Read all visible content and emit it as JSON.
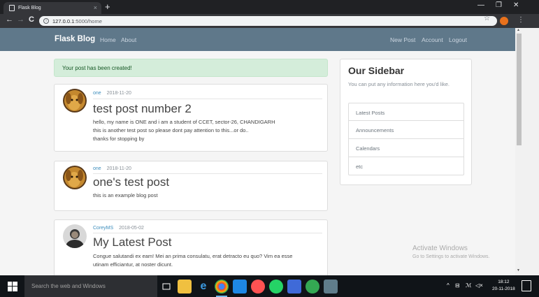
{
  "browser": {
    "tab_title": "Flask Blog",
    "tab_close": "×",
    "new_tab": "+",
    "url_host": "127.0.0.1",
    "url_path": ":5000/home",
    "window": {
      "minimize": "—",
      "maximize": "❐",
      "close": "✕"
    },
    "nav": {
      "back": "←",
      "forward": "→",
      "reload": "C"
    },
    "star": "☆",
    "menu": "⋮"
  },
  "site_nav": {
    "brand": "Flask Blog",
    "left_links": [
      "Home",
      "About"
    ],
    "right_links": [
      "New Post",
      "Account",
      "Logout"
    ]
  },
  "alert": "Your post has been created!",
  "posts": [
    {
      "author": "one",
      "date": "2018-11-20",
      "title": "test post number 2",
      "lines": [
        "hello, my name is ONE and i am a student of CCET, sector-26, CHANDIGARH",
        "this is another test post so please dont pay attention to this...or do..",
        "thanks for stopping by"
      ]
    },
    {
      "author": "one",
      "date": "2018-11-20",
      "title": "one's test post",
      "lines": [
        "this is an example blog post"
      ]
    },
    {
      "author": "CoreyMS",
      "date": "2018-05-02",
      "title": "My Latest Post",
      "lines": [
        "Congue salutandi ex eam! Mei an prima consulatu, erat detracto eu quo? Vim ea esse",
        "utinam efficiantur, at noster dicunt."
      ]
    }
  ],
  "sidebar": {
    "title": "Our Sidebar",
    "text": "You can put any information here you'd like.",
    "items": [
      "Latest Posts",
      "Announcements",
      "Calendars",
      "etc"
    ]
  },
  "watermark": {
    "line1": "Activate Windows",
    "line2": "Go to Settings to activate Windows."
  },
  "taskbar": {
    "search_placeholder": "Search the web and Windows",
    "time": "18:12",
    "date": "20-11-2018",
    "tray": {
      "up": "^",
      "network": "⊟",
      "cortana": "ℳ",
      "volume": "◁×"
    }
  },
  "colors": {
    "navbar": "#5f788a",
    "alert_bg": "#d4edda",
    "link": "#3c8dbc"
  }
}
